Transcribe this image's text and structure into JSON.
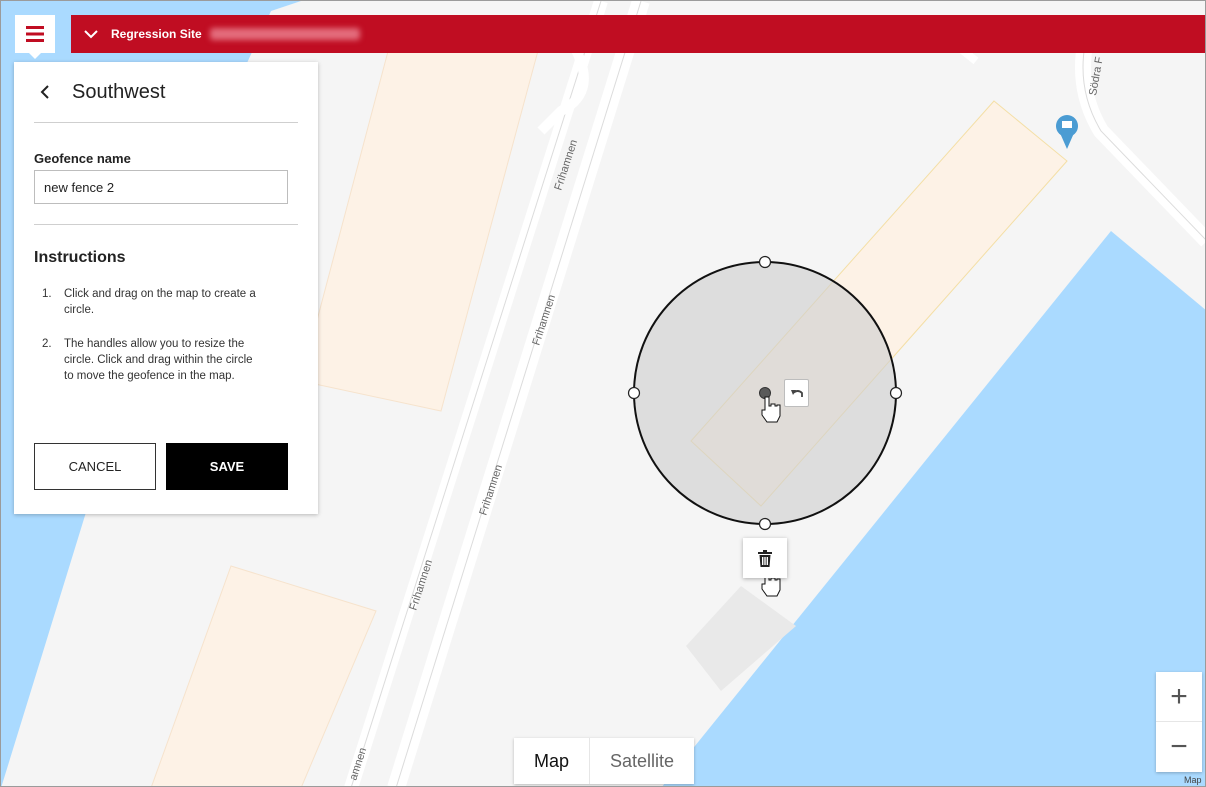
{
  "header": {
    "site_name": "Regression Site"
  },
  "panel": {
    "title": "Southwest",
    "name_label": "Geofence name",
    "name_value": "new fence 2",
    "instructions_title": "Instructions",
    "instructions": [
      {
        "num": "1.",
        "text": "Click and drag on the map to create a circle."
      },
      {
        "num": "2.",
        "text": "The handles allow you to resize the circle. Click and drag within the circle to move the geofence in the map."
      }
    ],
    "cancel_label": "CANCEL",
    "save_label": "SAVE"
  },
  "map": {
    "street_labels": [
      "Frihamnen",
      "Frihamnen",
      "Frihamnen",
      "Frihamnen",
      "amnen",
      "Södra F"
    ],
    "type_options": {
      "map": "Map",
      "satellite": "Satellite"
    },
    "zoom": {
      "in": "+",
      "out": "−"
    },
    "attribution": "Map"
  },
  "colors": {
    "accent": "#c00d22",
    "water": "#aadaff",
    "land": "#f5f5f5",
    "building": "#fdf2e6",
    "fence_fill": "#dedede",
    "fence_stroke": "#111111"
  },
  "icons": {
    "menu": "hamburger-icon",
    "site_toggle": "chevron-down-icon",
    "back": "chevron-left-icon",
    "delete": "trash-icon",
    "undo": "undo-icon",
    "poi": "ferry-terminal-icon",
    "cursor": "hand-pointer-icon"
  }
}
